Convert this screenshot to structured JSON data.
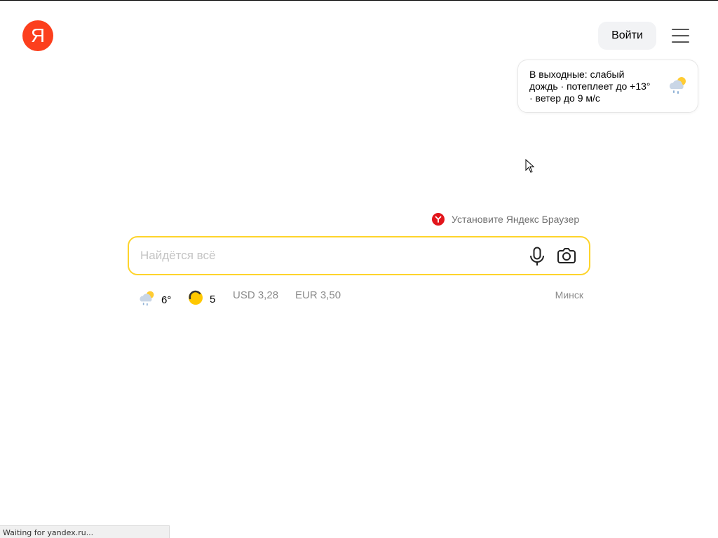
{
  "header": {
    "logo_letter": "Я",
    "login_label": "Войти",
    "menu_icon": "hamburger-icon"
  },
  "weather_card": {
    "text": "В выходные: слабый дождь · потеплеет до +13° · ветер до 9 м/с",
    "icon": "rain-sun-cloud-icon"
  },
  "promo": {
    "label": "Установите Яндекс Браузер",
    "icon": "yandex-browser-icon"
  },
  "search": {
    "placeholder": "Найдётся всё",
    "value": "",
    "accent_color": "#fed42b"
  },
  "info_row": {
    "temperature": "6°",
    "traffic_score": "5",
    "usd": "USD 3,28",
    "eur": "EUR 3,50",
    "city": "Минск"
  },
  "status_bar": {
    "text": "Waiting for yandex.ru..."
  },
  "colors": {
    "brand_red": "#fc3f1d",
    "search_border": "#fed42b",
    "traffic_yellow": "#ffc800"
  }
}
